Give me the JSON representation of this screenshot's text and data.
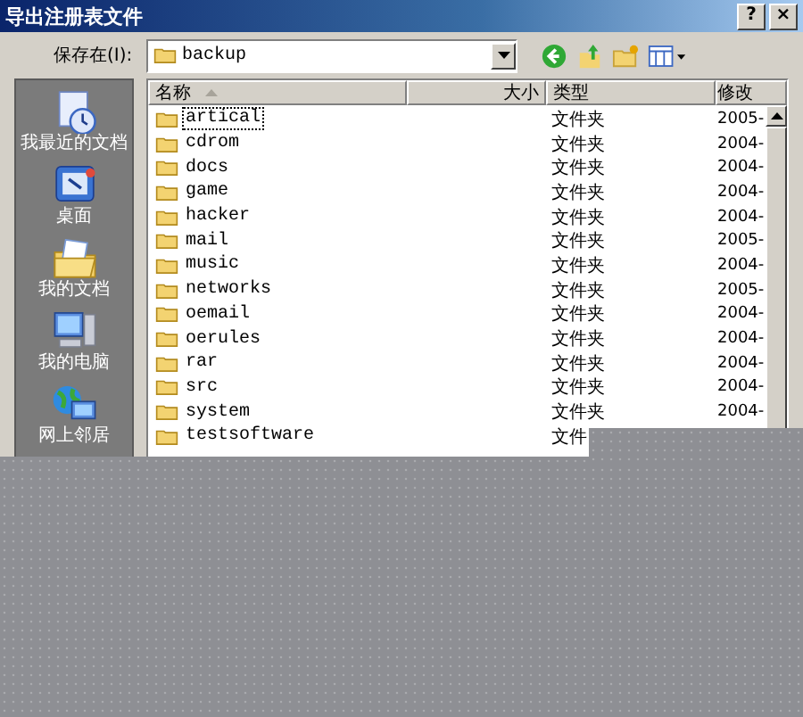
{
  "window": {
    "title": "导出注册表文件",
    "buttons": [
      "?",
      "×"
    ]
  },
  "location": {
    "label": "保存在(I):",
    "value": "backup"
  },
  "sidebar": {
    "items": [
      {
        "label": "我最近的文档",
        "kind": "recent"
      },
      {
        "label": "桌面",
        "kind": "desktop"
      },
      {
        "label": "我的文档",
        "kind": "documents"
      },
      {
        "label": "我的电脑",
        "kind": "computer"
      },
      {
        "label": "网上邻居",
        "kind": "network"
      }
    ]
  },
  "table": {
    "columns": [
      "名称",
      "大小",
      "类型",
      "修改"
    ],
    "rows": [
      {
        "name": "artical",
        "type": "文件夹",
        "modified": "2005-",
        "focused": true
      },
      {
        "name": "cdrom",
        "type": "文件夹",
        "modified": "2004-",
        "focused": false
      },
      {
        "name": "docs",
        "type": "文件夹",
        "modified": "2004-",
        "focused": false
      },
      {
        "name": "game",
        "type": "文件夹",
        "modified": "2004-",
        "focused": false
      },
      {
        "name": "hacker",
        "type": "文件夹",
        "modified": "2004-",
        "focused": false
      },
      {
        "name": "mail",
        "type": "文件夹",
        "modified": "2005-",
        "focused": false
      },
      {
        "name": "music",
        "type": "文件夹",
        "modified": "2004-",
        "focused": false
      },
      {
        "name": "networks",
        "type": "文件夹",
        "modified": "2005-",
        "focused": false
      },
      {
        "name": "oemail",
        "type": "文件夹",
        "modified": "2004-",
        "focused": false
      },
      {
        "name": "oerules",
        "type": "文件夹",
        "modified": "2004-",
        "focused": false
      },
      {
        "name": "rar",
        "type": "文件夹",
        "modified": "2004-",
        "focused": false
      },
      {
        "name": "src",
        "type": "文件夹",
        "modified": "2004-",
        "focused": false
      },
      {
        "name": "system",
        "type": "文件夹",
        "modified": "2004-",
        "focused": false
      },
      {
        "name": "testsoftware",
        "type": "文件",
        "focused": false
      }
    ]
  }
}
